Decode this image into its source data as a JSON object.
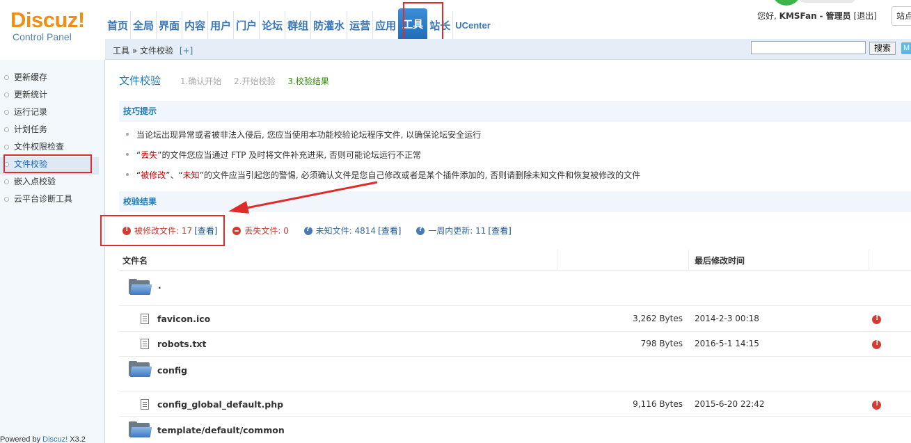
{
  "header": {
    "logo_title": "Discuz!",
    "logo_subtitle": "Control Panel",
    "nav": [
      "首页",
      "全局",
      "界面",
      "内容",
      "用户",
      "门户",
      "论坛",
      "群组",
      "防灌水",
      "运营",
      "应用",
      "工具",
      "站长",
      "UCenter"
    ],
    "active_nav": "工具",
    "greeting": "您好,",
    "username": "KMSFan",
    "role": "- 管理员",
    "logout": "[退出]",
    "site_button": "站点"
  },
  "breadcrumb": {
    "root": "工具",
    "sep": "»",
    "current": "文件校验",
    "add": "[+]",
    "search_button": "搜索",
    "m_button": "M"
  },
  "sidebar": {
    "items": [
      "更新缓存",
      "更新统计",
      "运行记录",
      "计划任务",
      "文件权限检查",
      "文件校验",
      "嵌入点校验",
      "云平台诊断工具"
    ],
    "active": "文件校验",
    "powered_prefix": "Powered by ",
    "powered_brand": "Discuz!",
    "powered_version": " X3.2"
  },
  "main": {
    "title": "文件校验",
    "steps": [
      "1.确认开始",
      "2.开始校验",
      "3.校验结果"
    ],
    "tips_title": "技巧提示",
    "tips": [
      {
        "pre": "当论坛出现异常或者被非法入侵后, 您应当使用本功能校验论坛程序文件, 以确保论坛安全运行",
        "red": "",
        "mid": "",
        "red2": "",
        "post": ""
      },
      {
        "pre": "“",
        "red": "丢失",
        "mid": "”的文件您应当通过 FTP 及时将文件补充进来, 否则可能论坛运行不正常",
        "red2": "",
        "post": ""
      },
      {
        "pre": "“",
        "red": "被修改",
        "mid": "”、“",
        "red2": "未知",
        "post": "”的文件应当引起您的警惕, 必须确认文件是您自己修改或者是某个插件添加的, 否则请删除未知文件和恢复被修改的文件"
      }
    ],
    "result_title": "校验结果",
    "stats": {
      "modified_label": "被修改文件: 17",
      "missing_label": "丢失文件: 0",
      "unknown_label": "未知文件: 4814",
      "week_label": "一周内更新: 11",
      "view": "[查看]"
    },
    "table": {
      "col_name": "文件名",
      "col_time": "最后修改时间",
      "rows": [
        {
          "type": "folder",
          "name": "."
        },
        {
          "type": "file",
          "name": "favicon.ico",
          "size": "3,262 Bytes",
          "time": "2014-2-3 00:18"
        },
        {
          "type": "file",
          "name": "robots.txt",
          "size": "798 Bytes",
          "time": "2016-5-1 14:15"
        },
        {
          "type": "folder",
          "name": "config"
        },
        {
          "type": "file",
          "name": "config_global_default.php",
          "size": "9,116 Bytes",
          "time": "2015-6-20 22:42"
        },
        {
          "type": "folder",
          "name": "template/default/common"
        }
      ]
    }
  },
  "colors": {
    "accent": "#3a77b8",
    "highlight": "#e02b2b",
    "brand_orange": "#f08f13",
    "step_current": "#2f8c00"
  }
}
